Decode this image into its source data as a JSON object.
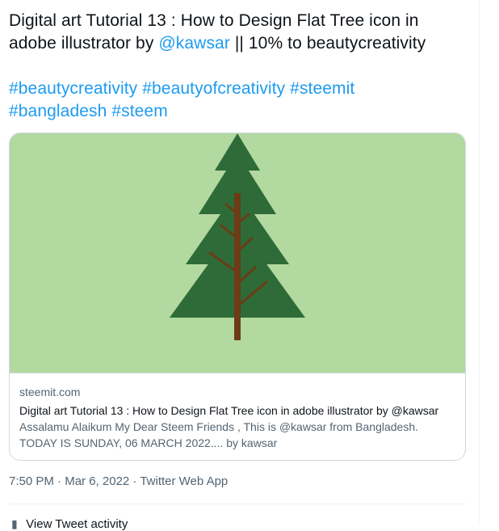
{
  "tweet": {
    "text_before_mention": "Digital art Tutorial 13 : How to Design Flat Tree icon in adobe illustrator by ",
    "mention": "@kawsar",
    "text_after_mention": " || 10% to beautycreativity",
    "hashtags": [
      "#beautycreativity",
      "#beautyofcreativity",
      "#steemit",
      "#bangladesh",
      "#steem"
    ]
  },
  "card": {
    "image_icon": "pine-tree-illustration",
    "colors": {
      "background": "#b2d99f",
      "foliage": "#2e6b38",
      "trunk": "#6b3c16"
    },
    "domain": "steemit.com",
    "title": "Digital art Tutorial 13 : How to Design Flat Tree icon in adobe illustrator by @kawsar",
    "description": "Assalamu Alaikum My Dear Steem Friends , This is @kawsar from Bangladesh. TODAY IS SUNDAY, 06 MARCH 2022.... by kawsar"
  },
  "meta": {
    "time": "7:50 PM",
    "separator": " · ",
    "date": "Mar 6, 2022",
    "source": "Twitter Web App"
  },
  "activity": {
    "icon": "bar-chart-icon",
    "label": "View Tweet activity"
  }
}
